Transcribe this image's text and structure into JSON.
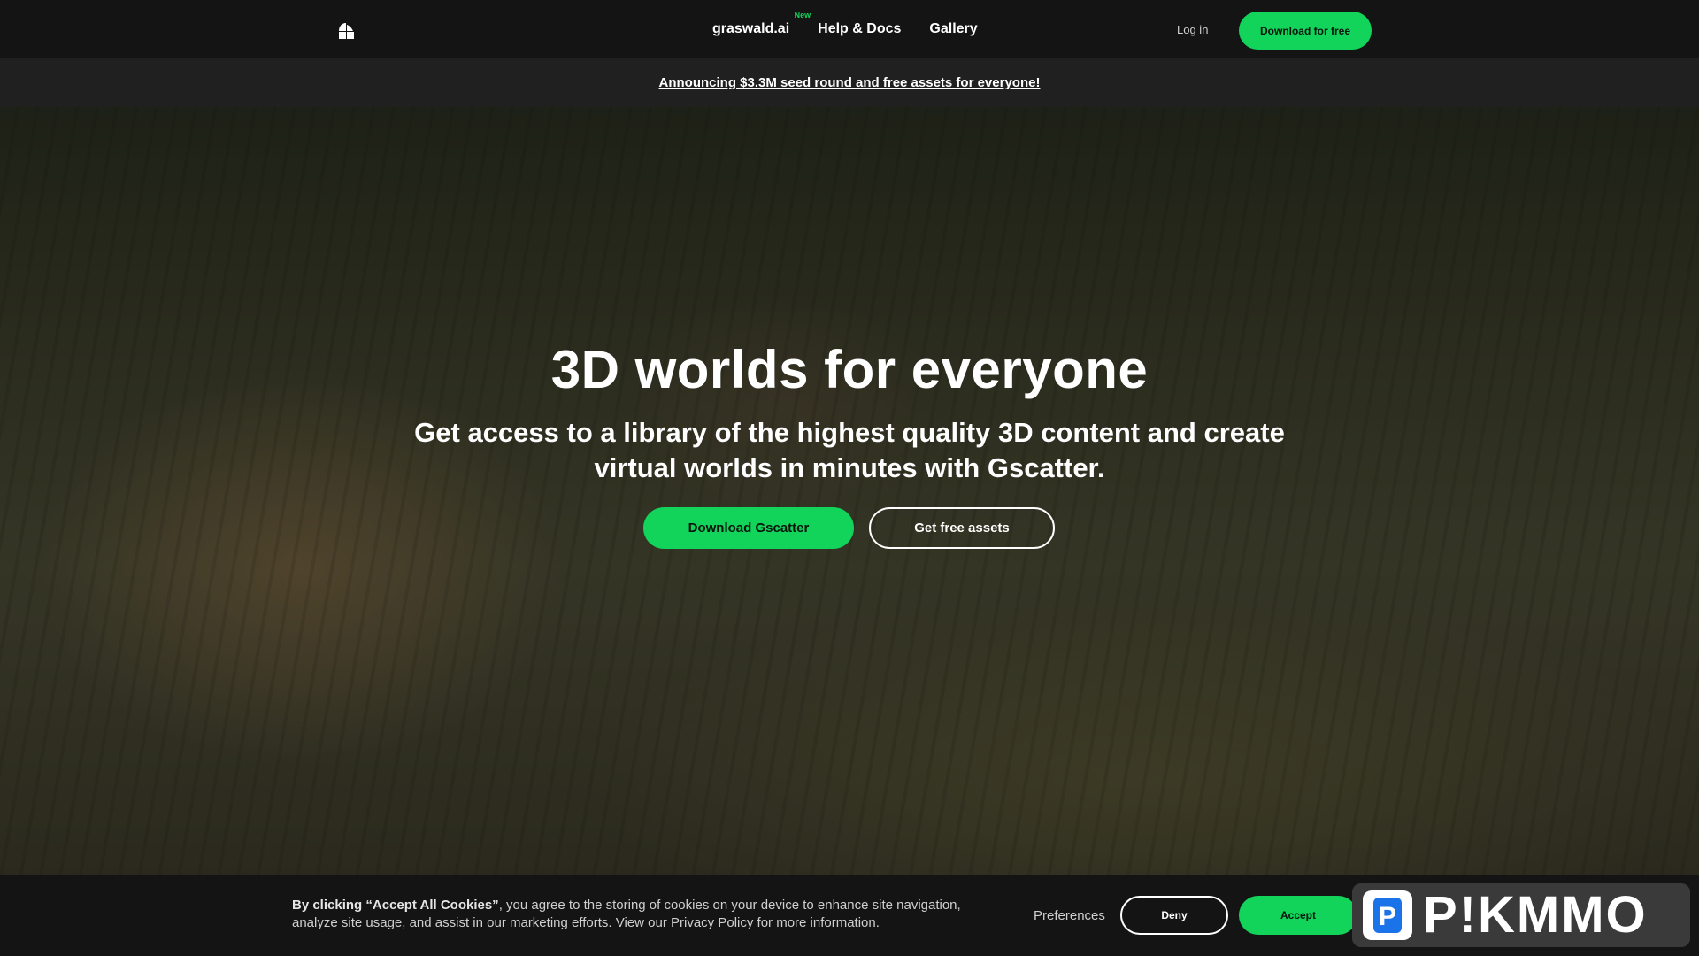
{
  "nav": {
    "links": [
      {
        "label": "graswald.ai",
        "badge": "New"
      },
      {
        "label": "Help & Docs"
      },
      {
        "label": "Gallery"
      }
    ],
    "login": "Log in",
    "download": "Download for free"
  },
  "announcement": "Announcing $3.3M seed round and free assets for everyone!",
  "hero": {
    "title": "3D worlds for everyone",
    "subtitle": "Get access to a library of the highest quality 3D content and create virtual worlds in minutes with Gscatter.",
    "primary_button": "Download Gscatter",
    "secondary_button": "Get free assets"
  },
  "cookie": {
    "text_bold": "By clicking “Accept All Cookies”",
    "text_rest": ", you agree to the storing of cookies on your device to enhance site navigation, analyze site usage, and assist in our marketing efforts. View our Privacy Policy for more information.",
    "preferences": "Preferences",
    "deny": "Deny",
    "accept": "Accept"
  },
  "watermark": {
    "text": "P!KMMO",
    "icon_letter": "P"
  },
  "colors": {
    "accent": "#12d45a",
    "nav_bg": "#141414",
    "announce_bg": "#202020"
  }
}
